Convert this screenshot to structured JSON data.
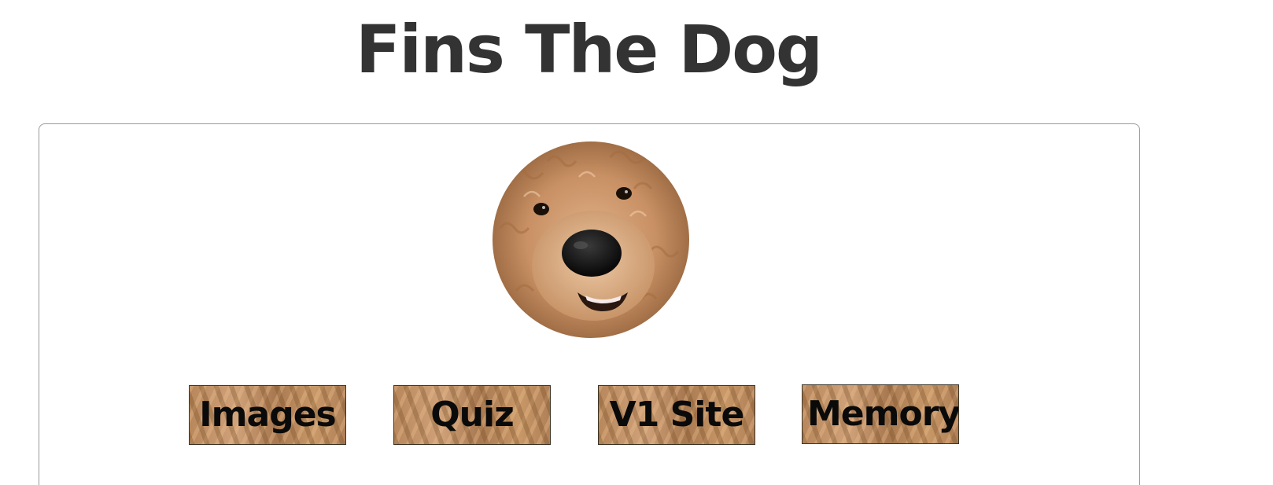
{
  "header": {
    "title": "Fins The Dog"
  },
  "profile": {
    "avatar_icon": "dog-face-photo"
  },
  "nav": {
    "buttons": [
      {
        "label": "Images"
      },
      {
        "label": "Quiz"
      },
      {
        "label": "V1 Site"
      },
      {
        "label": "Memory"
      }
    ]
  },
  "colors": {
    "title_text": "#333333",
    "card_border": "#9a9a9a",
    "button_texture": "#b8875c",
    "button_text": "#0a0a0a"
  }
}
